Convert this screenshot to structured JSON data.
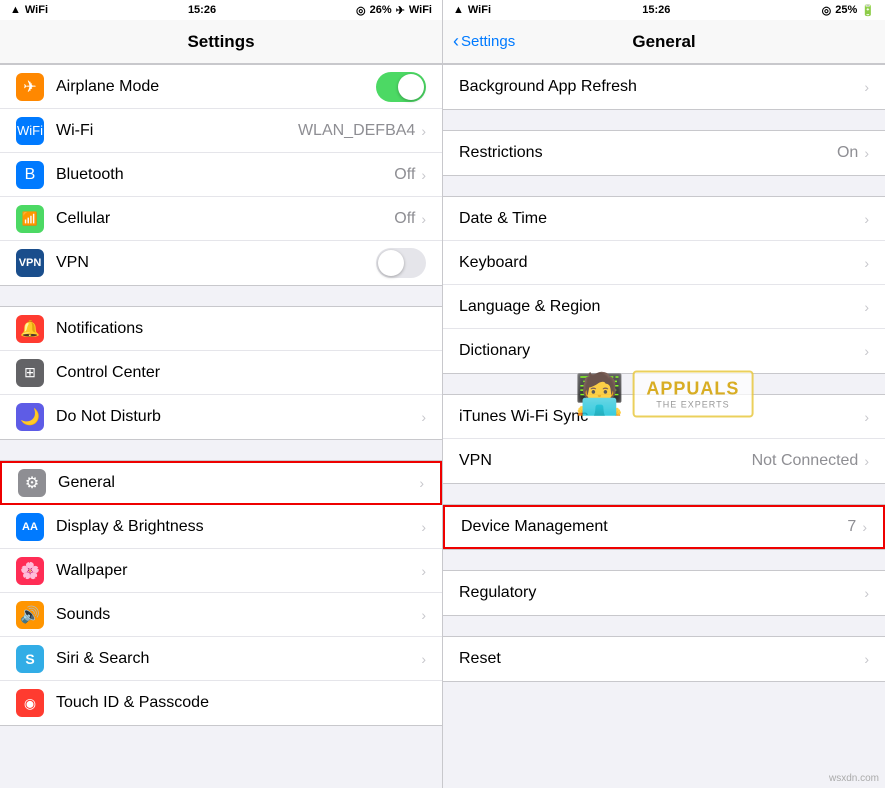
{
  "left_screen": {
    "status_bar": {
      "signal": "▲",
      "wifi": "WiFi",
      "time": "15:26",
      "location": "◎",
      "battery_pct": "26%",
      "airplane": "✈",
      "wifi2": "WiFi"
    },
    "nav_title": "Settings",
    "sections": [
      {
        "id": "connectivity",
        "rows": [
          {
            "id": "airplane-mode",
            "icon": "✈",
            "icon_color": "orange",
            "label": "Airplane Mode",
            "value": "",
            "toggle": true,
            "toggle_state": "on",
            "chevron": false
          },
          {
            "id": "wifi",
            "icon": "wifi",
            "icon_color": "blue",
            "label": "Wi-Fi",
            "value": "WLAN_DEFBA4",
            "chevron": true
          },
          {
            "id": "bluetooth",
            "icon": "bt",
            "icon_color": "blue",
            "label": "Bluetooth",
            "value": "Off",
            "chevron": true
          },
          {
            "id": "cellular",
            "icon": "cell",
            "icon_color": "green",
            "label": "Cellular",
            "value": "Off",
            "chevron": true
          },
          {
            "id": "vpn",
            "icon": "VPN",
            "icon_color": "dark-blue",
            "label": "VPN",
            "value": "",
            "toggle": true,
            "toggle_state": "off",
            "chevron": false
          }
        ]
      },
      {
        "id": "apps",
        "rows": [
          {
            "id": "notifications",
            "icon": "🔔",
            "icon_color": "red",
            "label": "Notifications",
            "value": "",
            "chevron": false
          },
          {
            "id": "control-center",
            "icon": "⊞",
            "icon_color": "dark-gray",
            "label": "Control Center",
            "value": "",
            "chevron": false
          },
          {
            "id": "do-not-disturb",
            "icon": "🌙",
            "icon_color": "purple2",
            "label": "Do Not Disturb",
            "value": "",
            "chevron": true
          }
        ]
      },
      {
        "id": "system",
        "rows": [
          {
            "id": "general",
            "icon": "⚙️",
            "icon_color": "gray",
            "label": "General",
            "value": "",
            "chevron": true,
            "highlighted": true
          },
          {
            "id": "display",
            "icon": "AA",
            "icon_color": "blue",
            "label": "Display & Brightness",
            "value": "",
            "chevron": true
          },
          {
            "id": "wallpaper",
            "icon": "🌸",
            "icon_color": "pink",
            "label": "Wallpaper",
            "value": "",
            "chevron": true
          },
          {
            "id": "sounds",
            "icon": "🔊",
            "icon_color": "orange2",
            "label": "Sounds",
            "value": "",
            "chevron": true
          },
          {
            "id": "siri",
            "icon": "S",
            "icon_color": "light-blue",
            "label": "Siri & Search",
            "value": "",
            "chevron": true
          },
          {
            "id": "touchid",
            "icon": "◉",
            "icon_color": "red",
            "label": "Touch ID & Passcode",
            "value": "",
            "chevron": false
          }
        ]
      }
    ]
  },
  "right_screen": {
    "status_bar": {
      "time": "15:26",
      "location": "◎",
      "battery_pct": "25%",
      "wifi": "WiFi"
    },
    "nav_back_label": "Settings",
    "nav_title": "General",
    "sections": [
      {
        "id": "refresh",
        "rows": [
          {
            "id": "background-refresh",
            "label": "Background App Refresh",
            "value": "",
            "chevron": true
          }
        ]
      },
      {
        "id": "restrictions",
        "rows": [
          {
            "id": "restrictions",
            "label": "Restrictions",
            "value": "On",
            "chevron": true
          }
        ]
      },
      {
        "id": "datetime",
        "rows": [
          {
            "id": "date-time",
            "label": "Date & Time",
            "value": "",
            "chevron": true
          },
          {
            "id": "keyboard",
            "label": "Keyboard",
            "value": "",
            "chevron": true
          },
          {
            "id": "language",
            "label": "Language & Region",
            "value": "",
            "chevron": true
          },
          {
            "id": "dictionary",
            "label": "Dictionary",
            "value": "",
            "chevron": true
          }
        ]
      },
      {
        "id": "itunes",
        "rows": [
          {
            "id": "itunes-sync",
            "label": "iTunes Wi-Fi Sync",
            "value": "",
            "chevron": true
          },
          {
            "id": "vpn",
            "label": "VPN",
            "value": "Not Connected",
            "chevron": true
          }
        ]
      },
      {
        "id": "device",
        "rows": [
          {
            "id": "device-management",
            "label": "Device Management",
            "value": "7",
            "chevron": true,
            "highlighted": true
          }
        ]
      },
      {
        "id": "regulatory",
        "rows": [
          {
            "id": "regulatory",
            "label": "Regulatory",
            "value": "",
            "chevron": true
          }
        ]
      },
      {
        "id": "reset",
        "rows": [
          {
            "id": "reset",
            "label": "Reset",
            "value": "",
            "chevron": true
          }
        ]
      }
    ]
  },
  "watermark": {
    "title": "APPUALS",
    "subtitle": "THE EXPERTS"
  },
  "footer": {
    "badge": "wsxdn.com"
  }
}
